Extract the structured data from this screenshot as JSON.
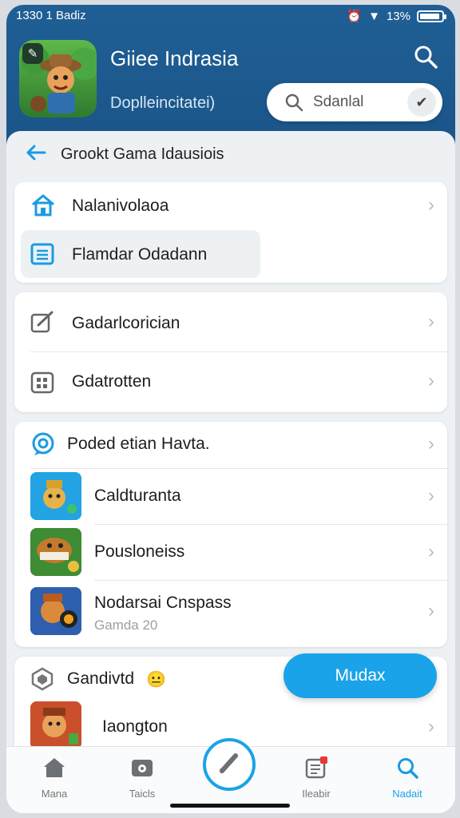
{
  "status_bar": {
    "time": "1330 1 Badiz",
    "battery": "13%"
  },
  "header": {
    "title": "Giiee Indrasia",
    "subtitle": "Doplleincitatei)",
    "search_placeholder": "Sdanlal"
  },
  "back_row": {
    "label": "Grookt Gama Idausiois"
  },
  "card1": [
    {
      "label": "Nalanivolaoa",
      "icon": "home-icon"
    },
    {
      "label": "Flamdar Odadann",
      "icon": "list-icon"
    }
  ],
  "card2": [
    {
      "label": "Gadarlcorician",
      "icon": "edit-icon"
    },
    {
      "label": "Gdatrotten",
      "icon": "grid-icon"
    }
  ],
  "card3": {
    "header": "Poded etian Havta.",
    "items": [
      {
        "title": "Caldturanta",
        "subtitle": ""
      },
      {
        "title": "Pousloneiss",
        "subtitle": ""
      },
      {
        "title": "Nodarsai Cnspass",
        "subtitle": "Gamda 20"
      }
    ]
  },
  "card4": {
    "header": "Gandivtd",
    "item": "Iaongton"
  },
  "fab_label": "Mudax",
  "bottom_nav": [
    {
      "label": "Mana",
      "icon": "home-icon"
    },
    {
      "label": "Taicls",
      "icon": "gamepad-icon"
    },
    {
      "label": "Ileabir",
      "icon": "notes-icon"
    },
    {
      "label": "Nadait",
      "icon": "search-icon"
    }
  ],
  "colors": {
    "header_blue": "#1f5f95",
    "accent": "#1aa3e8"
  }
}
